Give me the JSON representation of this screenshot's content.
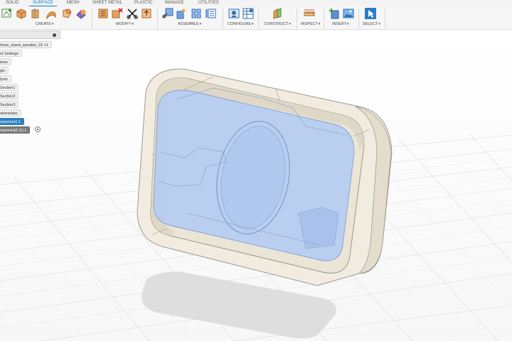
{
  "toolbar": {
    "tabs": [
      {
        "label": "SOLID"
      },
      {
        "label": "SURFACE"
      },
      {
        "label": "MESH"
      },
      {
        "label": "SHEET METAL"
      },
      {
        "label": "PLASTIC"
      },
      {
        "label": "MANAGE"
      },
      {
        "label": "UTILITIES"
      }
    ],
    "active_tab": "SURFACE",
    "groups": [
      {
        "label": "CREATE",
        "caret": "▾"
      },
      {
        "label": "MODIFY",
        "caret": "▾"
      },
      {
        "label": "ASSEMBLE",
        "caret": "▾"
      },
      {
        "label": "CONFIGURE",
        "caret": "▾"
      },
      {
        "label": "CONSTRUCT",
        "caret": "▾"
      },
      {
        "label": "INSPECT",
        "caret": "▾"
      },
      {
        "label": "INSERT",
        "caret": "▾"
      },
      {
        "label": "SELECT",
        "caret": "▾"
      }
    ],
    "accent_color": "#0a78c9"
  },
  "browser": {
    "nodes": [
      {
        "label": "hone_stand_speaker_02 v1"
      },
      {
        "label": "nt Settings"
      },
      {
        "label": "iews"
      },
      {
        "label": "gin"
      },
      {
        "label": "lysis"
      },
      {
        "label": "Section1"
      },
      {
        "label": "Section2"
      },
      {
        "label": "Section3"
      },
      {
        "label": "ationships"
      },
      {
        "label": "mponent1:1"
      },
      {
        "label": "mponent2 (1):1"
      }
    ],
    "selected_node": "mponent1:1"
  },
  "viewport": {
    "model_color": "#f1ecdf",
    "selection_color": "#b3ccf2"
  }
}
